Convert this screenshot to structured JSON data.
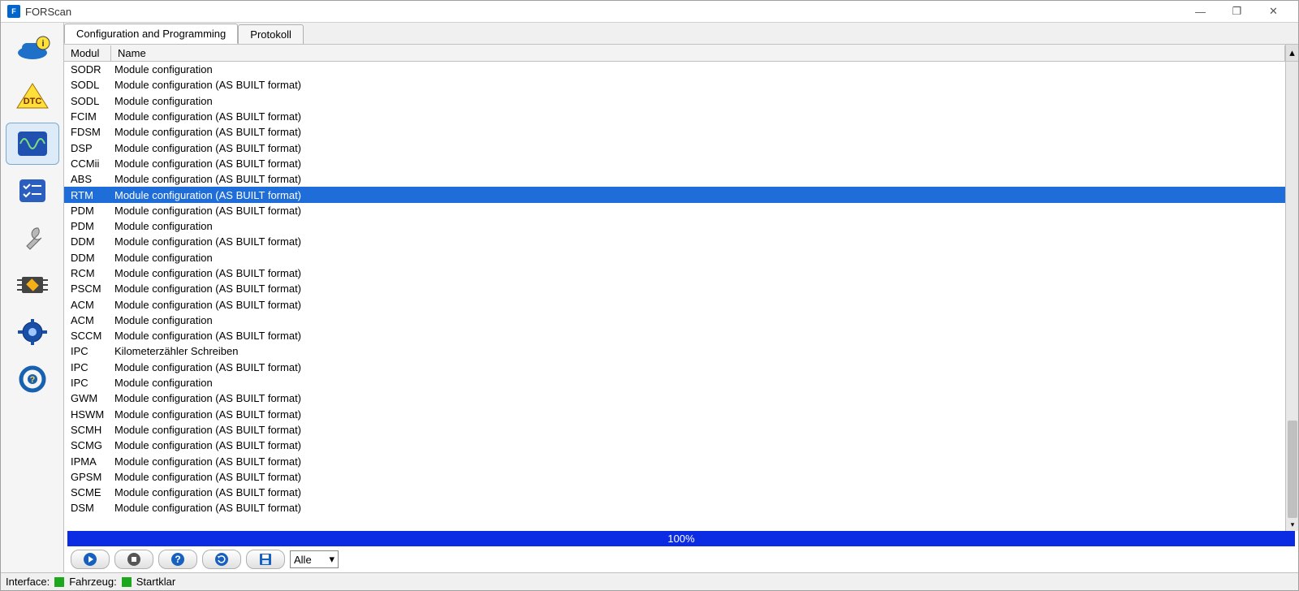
{
  "window": {
    "title": "FORScan"
  },
  "tabs": [
    {
      "label": "Configuration and Programming",
      "active": true
    },
    {
      "label": "Protokoll",
      "active": false
    }
  ],
  "columns": {
    "modul": "Modul",
    "name": "Name"
  },
  "rows": [
    {
      "modul": "SODR",
      "name": "Module configuration"
    },
    {
      "modul": "SODL",
      "name": "Module configuration (AS BUILT format)"
    },
    {
      "modul": "SODL",
      "name": "Module configuration"
    },
    {
      "modul": "FCIM",
      "name": "Module configuration (AS BUILT format)"
    },
    {
      "modul": "FDSM",
      "name": "Module configuration (AS BUILT format)"
    },
    {
      "modul": "DSP",
      "name": "Module configuration (AS BUILT format)"
    },
    {
      "modul": "CCMii",
      "name": "Module configuration (AS BUILT format)"
    },
    {
      "modul": "ABS",
      "name": "Module configuration (AS BUILT format)"
    },
    {
      "modul": "RTM",
      "name": "Module configuration (AS BUILT format)",
      "selected": true
    },
    {
      "modul": "PDM",
      "name": "Module configuration (AS BUILT format)"
    },
    {
      "modul": "PDM",
      "name": "Module configuration"
    },
    {
      "modul": "DDM",
      "name": "Module configuration (AS BUILT format)"
    },
    {
      "modul": "DDM",
      "name": "Module configuration"
    },
    {
      "modul": "RCM",
      "name": "Module configuration (AS BUILT format)"
    },
    {
      "modul": "PSCM",
      "name": "Module configuration (AS BUILT format)"
    },
    {
      "modul": "ACM",
      "name": "Module configuration (AS BUILT format)"
    },
    {
      "modul": "ACM",
      "name": "Module configuration"
    },
    {
      "modul": "SCCM",
      "name": "Module configuration (AS BUILT format)"
    },
    {
      "modul": "IPC",
      "name": "Kilometerzähler Schreiben"
    },
    {
      "modul": "IPC",
      "name": "Module configuration (AS BUILT format)"
    },
    {
      "modul": "IPC",
      "name": "Module configuration"
    },
    {
      "modul": "GWM",
      "name": "Module configuration (AS BUILT format)"
    },
    {
      "modul": "HSWM",
      "name": "Module configuration (AS BUILT format)"
    },
    {
      "modul": "SCMH",
      "name": "Module configuration (AS BUILT format)"
    },
    {
      "modul": "SCMG",
      "name": "Module configuration (AS BUILT format)"
    },
    {
      "modul": "IPMA",
      "name": "Module configuration (AS BUILT format)"
    },
    {
      "modul": "GPSM",
      "name": "Module configuration (AS BUILT format)"
    },
    {
      "modul": "SCME",
      "name": "Module configuration (AS BUILT format)"
    },
    {
      "modul": "DSM",
      "name": "Module configuration (AS BUILT format)"
    }
  ],
  "progress": {
    "text": "100%"
  },
  "filter": {
    "value": "Alle"
  },
  "sidebar": {
    "items": [
      {
        "name": "vehicle-info-icon"
      },
      {
        "name": "dtc-icon"
      },
      {
        "name": "oscilloscope-icon"
      },
      {
        "name": "checklist-icon"
      },
      {
        "name": "wrench-icon"
      },
      {
        "name": "chip-icon"
      },
      {
        "name": "gear-icon"
      },
      {
        "name": "steering-help-icon"
      }
    ]
  },
  "titlebar_controls": {
    "minimize": "—",
    "maximize": "❐",
    "close": "✕"
  },
  "status": {
    "interface_label": "Interface:",
    "fahrzeug_label": "Fahrzeug:",
    "ready_label": "Startklar"
  }
}
